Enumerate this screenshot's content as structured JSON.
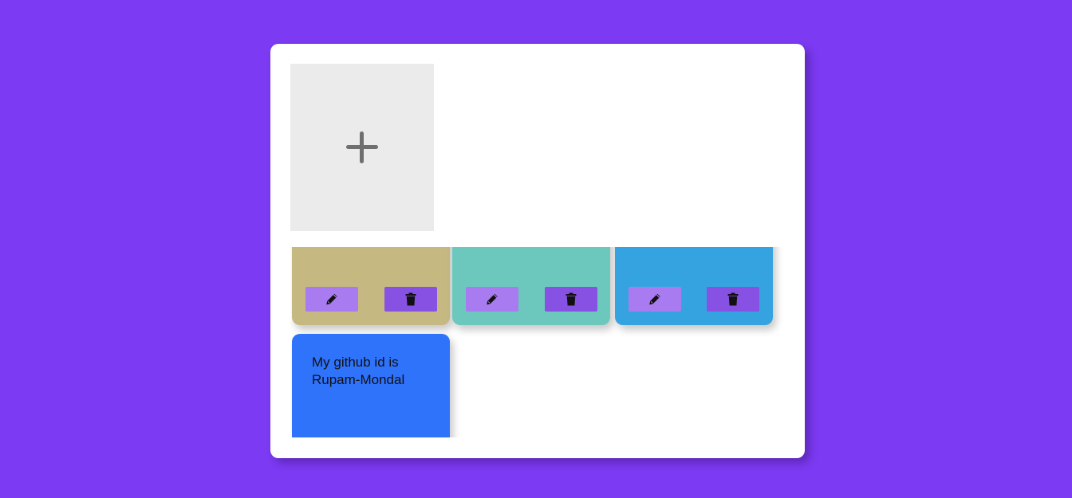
{
  "add_note": {
    "icon": "plus-icon"
  },
  "notes": [
    {
      "text": "",
      "color": "#c6b881",
      "edit_icon": "pencil-icon",
      "delete_icon": "trash-icon"
    },
    {
      "text": "",
      "color": "#6cc8bd",
      "edit_icon": "pencil-icon",
      "delete_icon": "trash-icon"
    },
    {
      "text": "",
      "color": "#36a3e1",
      "edit_icon": "pencil-icon",
      "delete_icon": "trash-icon"
    },
    {
      "text": "My github id is Rupam-Mondal",
      "color": "#2f73fb"
    }
  ],
  "colors": {
    "background": "#7c3af2",
    "panel": "#ffffff",
    "add_tile": "#ebebeb",
    "edit_button": "#a87cf0",
    "delete_button": "#8752e3",
    "icon": "#111111"
  }
}
